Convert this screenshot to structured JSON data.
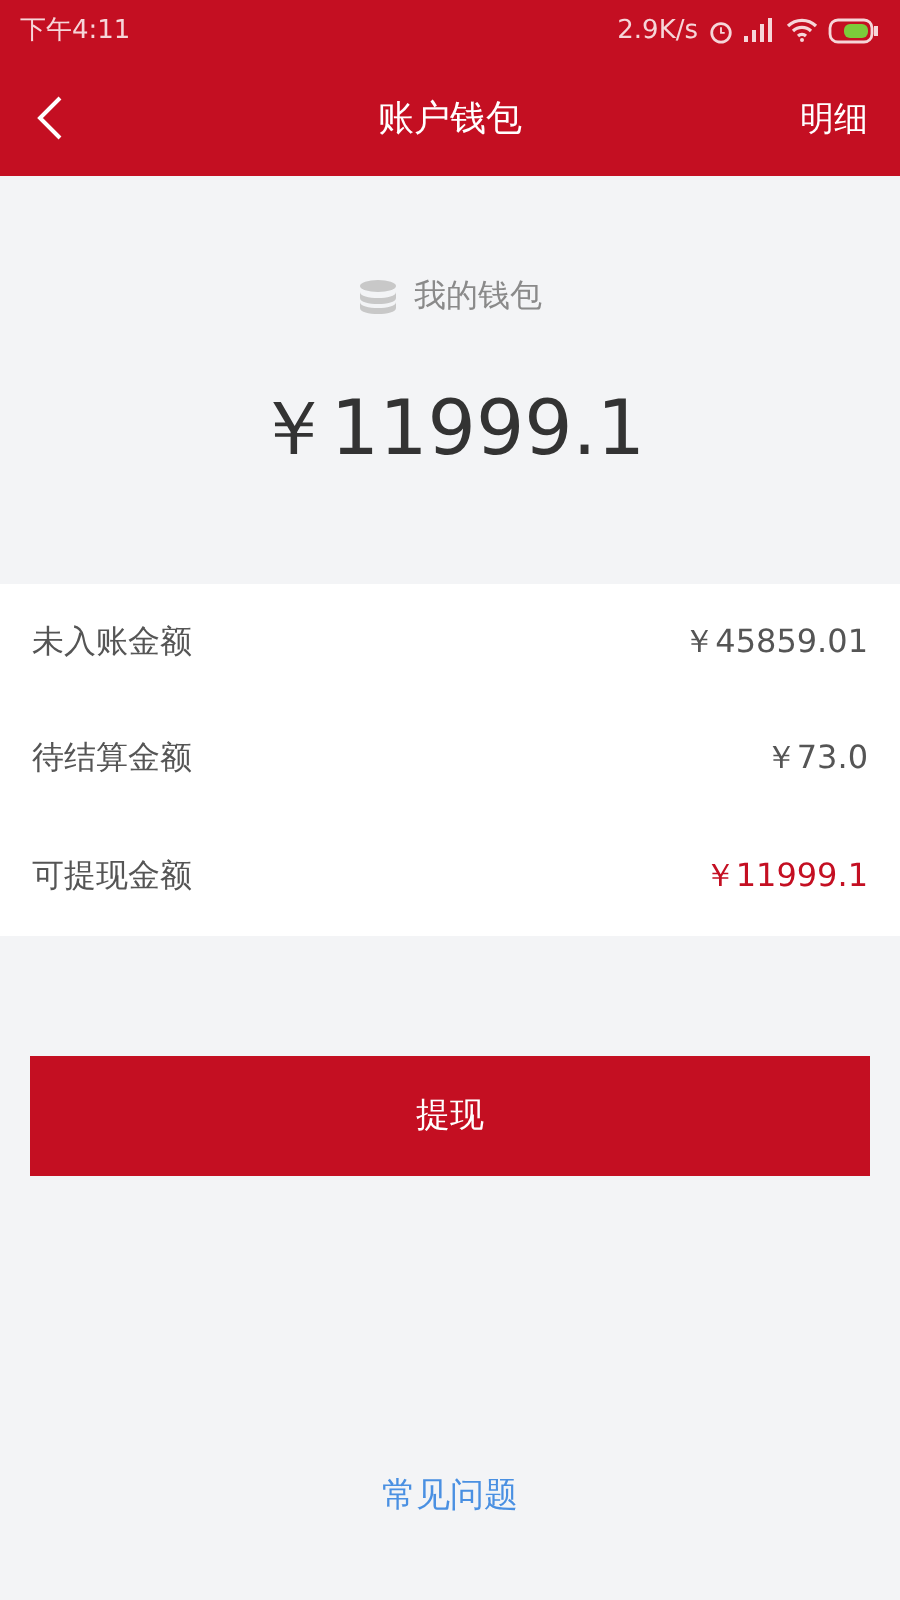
{
  "status_bar": {
    "time": "下午4:11",
    "speed": "2.9K/s"
  },
  "nav": {
    "title": "账户钱包",
    "action": "明细"
  },
  "wallet": {
    "label": "我的钱包",
    "balance": "￥11999.1"
  },
  "rows": [
    {
      "label": "未入账金额",
      "value": "￥45859.01",
      "highlight": false
    },
    {
      "label": "待结算金额",
      "value": "￥73.0",
      "highlight": false
    },
    {
      "label": "可提现金额",
      "value": "￥11999.1",
      "highlight": true
    }
  ],
  "button": "提现",
  "faq_link": "常见问题"
}
